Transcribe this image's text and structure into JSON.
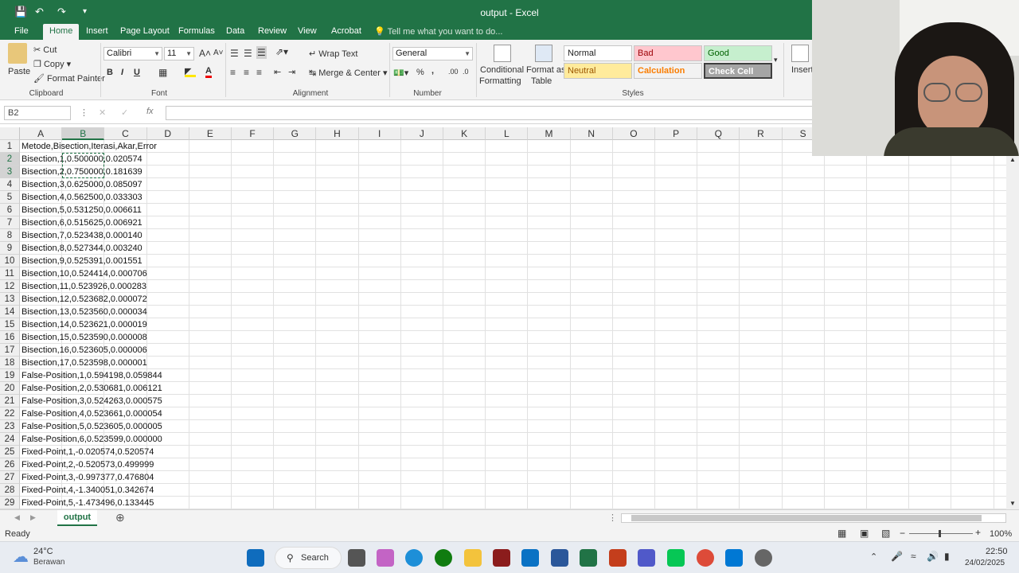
{
  "window": {
    "title": "output - Excel"
  },
  "tabs": [
    "File",
    "Home",
    "Insert",
    "Page Layout",
    "Formulas",
    "Data",
    "Review",
    "View",
    "Acrobat"
  ],
  "tell_me": "Tell me what you want to do...",
  "ribbon": {
    "clipboard": {
      "paste": "Paste",
      "cut": "Cut",
      "copy": "Copy",
      "format_painter": "Format Painter",
      "label": "Clipboard"
    },
    "font": {
      "name": "Calibri",
      "size": "11",
      "bold": "B",
      "italic": "I",
      "underline": "U",
      "label": "Font"
    },
    "alignment": {
      "wrap": "Wrap Text",
      "merge": "Merge & Center",
      "label": "Alignment"
    },
    "number": {
      "format": "General",
      "percent": "%",
      "comma": ",",
      "label": "Number"
    },
    "styles": {
      "conditional": "Conditional",
      "conditional2": "Formatting",
      "format_as": "Format as",
      "format_as2": "Table",
      "normal": "Normal",
      "bad": "Bad",
      "good": "Good",
      "neutral": "Neutral",
      "calculation": "Calculation",
      "check_cell": "Check Cell",
      "label": "Styles"
    },
    "cells": {
      "insert": "Insert"
    }
  },
  "formula_bar": {
    "name_box": "B2",
    "fx": "fx"
  },
  "columns": [
    "A",
    "B",
    "C",
    "D",
    "E",
    "F",
    "G",
    "H",
    "I",
    "J",
    "K",
    "L",
    "M",
    "N",
    "O",
    "P",
    "Q",
    "R",
    "S"
  ],
  "rows": [
    "Metode,Bisection,Iterasi,Akar,Error",
    "Bisection,1,0.500000,0.020574",
    "Bisection,2,0.750000,0.181639",
    "Bisection,3,0.625000,0.085097",
    "Bisection,4,0.562500,0.033303",
    "Bisection,5,0.531250,0.006611",
    "Bisection,6,0.515625,0.006921",
    "Bisection,7,0.523438,0.000140",
    "Bisection,8,0.527344,0.003240",
    "Bisection,9,0.525391,0.001551",
    "Bisection,10,0.524414,0.000706",
    "Bisection,11,0.523926,0.000283",
    "Bisection,12,0.523682,0.000072",
    "Bisection,13,0.523560,0.000034",
    "Bisection,14,0.523621,0.000019",
    "Bisection,15,0.523590,0.000008",
    "Bisection,16,0.523605,0.000006",
    "Bisection,17,0.523598,0.000001",
    "False-Position,1,0.594198,0.059844",
    "False-Position,2,0.530681,0.006121",
    "False-Position,3,0.524263,0.000575",
    "False-Position,4,0.523661,0.000054",
    "False-Position,5,0.523605,0.000005",
    "False-Position,6,0.523599,0.000000",
    "Fixed-Point,1,-0.020574,0.520574",
    "Fixed-Point,2,-0.520573,0.499999",
    "Fixed-Point,3,-0.997377,0.476804",
    "Fixed-Point,4,-1.340051,0.342674",
    "Fixed-Point,5,-1.473496,0.133445"
  ],
  "sheet": {
    "tab": "output"
  },
  "status": {
    "ready": "Ready",
    "zoom": "100%"
  },
  "taskbar": {
    "weather_temp": "24°C",
    "weather_desc": "Berawan",
    "search": "Search",
    "time": "22:50",
    "date": "24/02/2025"
  },
  "colors": {
    "excel_green": "#217346"
  }
}
